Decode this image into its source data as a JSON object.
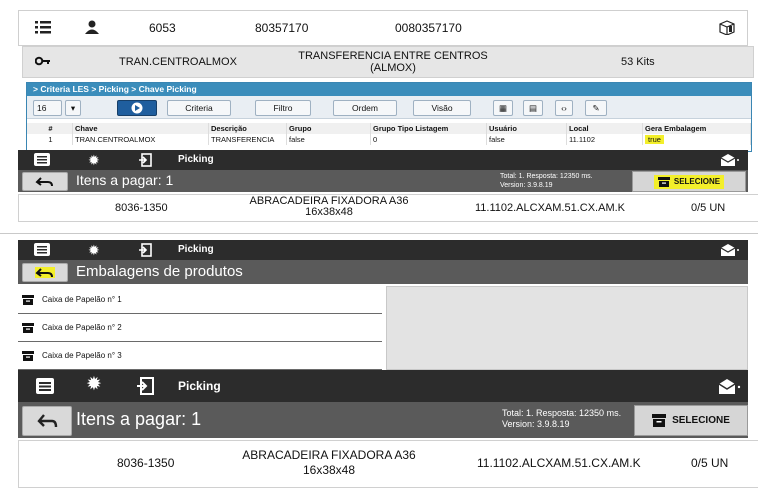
{
  "top_row": {
    "number": "6053",
    "code": "80357170",
    "code_padded": "0080357170"
  },
  "second_row": {
    "name": "TRAN.CENTROALMOX",
    "description_line1": "TRANSFERENCIA ENTRE CENTROS",
    "description_line2": "(ALMOX)",
    "kits": "53 Kits"
  },
  "criteria": {
    "breadcrumb": "> Criteria LES > Picking > Chave Picking",
    "page_size": "16",
    "buttons": {
      "criteria": "Criteria",
      "filtro": "Filtro",
      "ordem": "Ordem",
      "visao": "Visão"
    },
    "columns": [
      "#",
      "Chave",
      "Descrição",
      "Grupo",
      "Grupo Tipo Listagem",
      "Usuário",
      "Local",
      "Gera Embalagem"
    ],
    "row": [
      "1",
      "TRAN.CENTROALMOX",
      "TRANSFERENCIA",
      "false",
      "0",
      "false",
      "11.1102",
      "true"
    ]
  },
  "small_app": {
    "title": "Picking",
    "heading": "Itens a pagar: 1",
    "total_line": "Total: 1. Resposta: 12350 ms.",
    "version_line": "Version: 3.9.8.19",
    "select_label": "SELECIONE",
    "item": {
      "code": "8036-1350",
      "desc_line1": "ABRACADEIRA FIXADORA A36",
      "desc_line2": "16x38x48",
      "location": "11.1102.ALCXAM.51.CX.AM.K",
      "qty": "0/5 UN"
    }
  },
  "packaging_app": {
    "title": "Picking",
    "heading": "Embalagens de produtos",
    "items": [
      "Caixa de Papelão n° 1",
      "Caixa de Papelão n° 2",
      "Caixa de Papelão n° 3"
    ]
  },
  "large_app": {
    "title": "Picking",
    "heading": "Itens a pagar: 1",
    "total_line": "Total: 1. Resposta: 12350 ms.",
    "version_line": "Version: 3.9.8.19",
    "select_label": "SELECIONE",
    "item": {
      "code": "8036-1350",
      "desc_line1": "ABRACADEIRA FIXADORA A36",
      "desc_line2": "16x38x48",
      "location": "11.1102.ALCXAM.51.CX.AM.K",
      "qty": "0/5 UN"
    }
  },
  "icons": [
    "list-icon",
    "user-icon",
    "box-icon",
    "key-icon",
    "settings-icon",
    "exit-icon",
    "back-icon",
    "mail-icon"
  ],
  "colors": {
    "accent_blue": "#3b8dbb",
    "highlight_yellow": "#f3ef2a",
    "bar_dark": "#2c2c2c",
    "bar_mid": "#5a5a5a"
  }
}
